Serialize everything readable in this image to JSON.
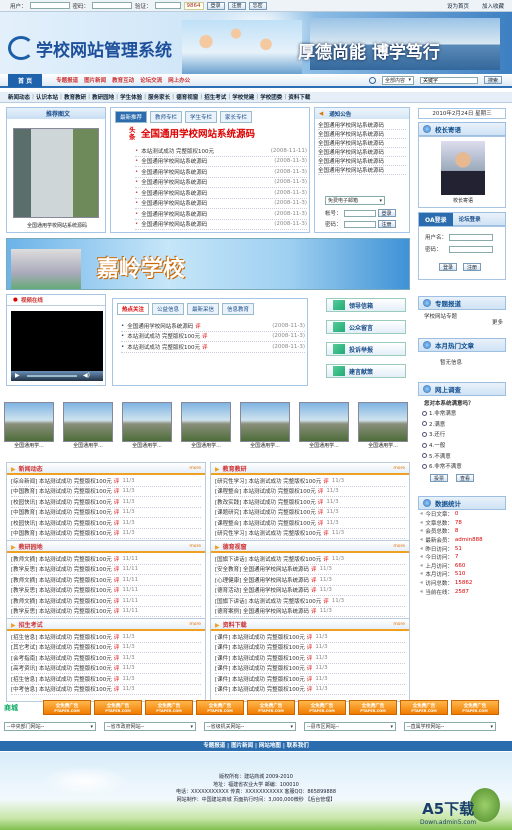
{
  "login": {
    "user_label": "用户：",
    "pass_label": "密码：",
    "code_label": "验证：",
    "code_value": "9864",
    "login_btn": "登录",
    "reg_btn": "注册",
    "forgot_btn": "忘密",
    "home_link": "设为首页",
    "fav_link": "加入收藏"
  },
  "header": {
    "logo": "学校网站管理系统",
    "slogan": "厚德尚能 博学笃行"
  },
  "nav": {
    "home": "首 页",
    "items": [
      "专题报道",
      "图片新闻",
      "教育互动",
      "论坛交流",
      "网上办公"
    ],
    "search_select": "全部内容",
    "search_value": "关键字",
    "search_btn": "搜索"
  },
  "subnav": [
    "新闻动态",
    "认识本站",
    "教育教研",
    "教研园地",
    "学生体验",
    "服务家长",
    "德育视窗",
    "招生考试",
    "学校党建",
    "学校团委",
    "资料下载"
  ],
  "pic_news": {
    "title": "推荐图文",
    "caption": "全国通用学校网站系统源码"
  },
  "headline": {
    "tabs": [
      "最新推荐",
      "教师专栏",
      "学生专栏",
      "家长专栏"
    ],
    "tag": "头条",
    "title": "全国通用学校网站系统源码",
    "items": [
      {
        "t": "本站测试成功 完整版权100元",
        "d": "(2008-11-11)"
      },
      {
        "t": "全国通用学校网站系统源码",
        "d": "(2008-11-3)"
      },
      {
        "t": "全国通用学校网站系统源码",
        "d": "(2008-11-3)"
      },
      {
        "t": "全国通用学校网站系统源码",
        "d": "(2008-11-3)"
      },
      {
        "t": "全国通用学校网站系统源码",
        "d": "(2008-11-3)"
      },
      {
        "t": "全国通用学校网站系统源码",
        "d": "(2008-11-3)"
      },
      {
        "t": "全国通用学校网站系统源码",
        "d": "(2008-11-3)"
      },
      {
        "t": "全国通用学校网站系统源码",
        "d": "(2008-11-3)"
      }
    ]
  },
  "notice": {
    "title": "通知公告",
    "items": [
      "全国通用学校网站系统源码",
      "全国通用学校网站系统源码",
      "全国通用学校网站系统源码",
      "全国通用学校网站系统源码",
      "全国通用学校网站系统源码",
      "全国通用学校网站系统源码"
    ],
    "mail_select": "免费电子邮箱",
    "acct": "帐号：",
    "pwd": "密码：",
    "login": "登录",
    "reg": "注册"
  },
  "right": {
    "date": "2010年2月24日 星期三",
    "speech_title": "校长寄语",
    "speech_name": "校长寄语",
    "oa_title": "OA登录",
    "forum": "论坛登录",
    "user": "用户名：",
    "pass": "密码：",
    "login": "登录",
    "reg": "注册",
    "special_title": "专题报道",
    "special_item": "学校网站专题",
    "more": "更多",
    "hot_title": "本月热门文章",
    "hot_empty": "暂无信息",
    "survey_title": "网上调查",
    "survey_q": "您对本系统满意吗？",
    "survey_opts": [
      "1.非常满意",
      "2.满意",
      "3.还行",
      "4.一般",
      "5.不满意",
      "6.非常不满意"
    ],
    "vote": "投票",
    "view": "查看",
    "stat_title": "数据统计",
    "stats": [
      {
        "k": "今日文章：",
        "v": "0"
      },
      {
        "k": "文章总数：",
        "v": "78"
      },
      {
        "k": "会员总数：",
        "v": "8"
      },
      {
        "k": "最新会员：",
        "v": "admin888"
      },
      {
        "k": "昨日访问：",
        "v": "51"
      },
      {
        "k": "今日访问：",
        "v": "7"
      },
      {
        "k": "上月访问：",
        "v": "660"
      },
      {
        "k": "本月访问：",
        "v": "510"
      },
      {
        "k": "访问总数：",
        "v": "15862"
      },
      {
        "k": "当前在线：",
        "v": "2587"
      }
    ]
  },
  "banner": {
    "text": "嘉岭学校"
  },
  "video": {
    "title": "视频在线"
  },
  "mid_tabs": [
    "热点关注",
    "公益信息",
    "最新采信",
    "信息教育"
  ],
  "mid_items": [
    {
      "t": "全国通用学校网站系统源码",
      "d": "(2008-11-3)"
    },
    {
      "t": "本站测试成功 完整版权100元",
      "d": "(2008-11-3)"
    },
    {
      "t": "本站测试成功 完整版权100元",
      "d": "(2008-11-3)"
    }
  ],
  "func_btns": [
    "领导信箱",
    "公众留言",
    "投诉举报",
    "建言献策"
  ],
  "gallery": {
    "caption": "全国通用学..."
  },
  "sec1": {
    "title": "新闻动态",
    "items": [
      "[综合新闻] 本站测试成功 完整版权100元",
      "[中国教育] 本站测试成功 完整版权100元",
      "[校园快讯] 本站测试成功 完整版权100元",
      "[中国教育] 本站测试成功 完整版权100元",
      "[校园快讯] 本站测试成功 完整版权100元",
      "[中国教育] 本站测试成功 完整版权100元"
    ],
    "date": "11/3"
  },
  "sec2": {
    "title": "教育教研",
    "items": [
      "[研究性学习] 本站测试成功 完整版权100元",
      "[课程整合] 本站测试成功 完整版权100元",
      "[教改实践] 本站测试成功 完整版权100元",
      "[课题研究] 本站测试成功 完整版权100元",
      "[课程整合] 本站测试成功 完整版权100元",
      "[研究性学习] 本站测试成功 完整版权100元"
    ],
    "date": "11/3"
  },
  "sec3": {
    "title": "教研园地",
    "items": [
      "[教师文摘] 本站测试成功 完整版权100元",
      "[教学反思] 本站测试成功 完整版权100元",
      "[教师文摘] 本站测试成功 完整版权100元",
      "[教学反思] 本站测试成功 完整版权100元",
      "[教师文摘] 本站测试成功 完整版权100元",
      "[教学反思] 本站测试成功 完整版权100元"
    ],
    "date": "11/11"
  },
  "sec4": {
    "title": "德育视窗",
    "items": [
      "[国旗下讲话] 本站测试成功 完整版权100元",
      "[安全教育] 全国通用学校网站系统源码",
      "[心理健康] 全国通用学校网站系统源码",
      "[德育活动] 全国通用学校网站系统源码",
      "[国旗下讲话] 本站测试成功 完整版权100元",
      "[德育案例] 全国通用学校网站系统源码"
    ],
    "date": "11/3"
  },
  "sec5": {
    "title": "招生考试",
    "items": [
      "[招生信息] 本站测试成功 完整版权100元",
      "[其它考试] 本站测试成功 完整版权100元",
      "[会考指南] 本站测试成功 完整版权100元",
      "[高考资讯] 本站测试成功 完整版权100元",
      "[招生信息] 本站测试成功 完整版权100元",
      "[中考信息] 本站测试成功 完整版权100元"
    ],
    "date": "11/3"
  },
  "sec6": {
    "title": "资料下载",
    "items": [
      "[课件] 本站测试成功 完整版权100元",
      "[课件] 本站测试成功 完整版权100元",
      "[课件] 本站测试成功 完整版权100元",
      "[课件] 本站测试成功 完整版权100元",
      "[课件] 本站测试成功 完整版权100元",
      "[课件] 本站测试成功 完整版权100元"
    ],
    "date": "11/3"
  },
  "hot_tag": "评",
  "more": "more",
  "ads": {
    "mall": "商城",
    "ad": "全免费广告",
    "sub": "PTAPER.COM"
  },
  "links": [
    "--中央部门网站--",
    "--省市政府网站--",
    "--省级机关网站--",
    "--县市区网站--",
    "--直属学校网站--"
  ],
  "footer_nav": "专题报道 | 图片新闻 | 网站地图 | 联系我们",
  "footer": {
    "l1": "版权所有：建站商城 2009-2010",
    "l2": "地址：福建省农业大学 邮编：100010",
    "l3": "电话：XXXXXXXXXXX 传真：XXXXXXXXXXX 客服QQ：865899888",
    "l4": "网站制作：中国建站商城 页面执行时间：3,000,000微秒 【后台管理】"
  },
  "watermark": {
    "t": "A5下载",
    "s": "Down.admin5.com"
  }
}
